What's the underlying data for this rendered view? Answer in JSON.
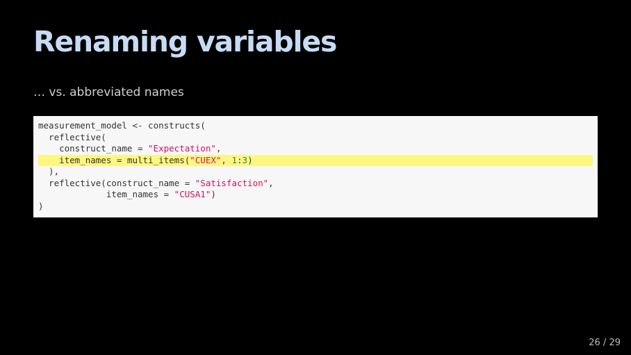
{
  "slide": {
    "title": "Renaming variables",
    "subtitle": "… vs. abbreviated names",
    "page_current": "26",
    "page_separator": " / ",
    "page_total": "29"
  },
  "code": {
    "language": "r",
    "highlighted_line_index": 3,
    "lines": [
      {
        "tokens": [
          {
            "text": "measurement_model <- constructs(",
            "kind": "plain"
          }
        ]
      },
      {
        "tokens": [
          {
            "text": "  reflective(",
            "kind": "plain"
          }
        ]
      },
      {
        "tokens": [
          {
            "text": "    construct_name = ",
            "kind": "plain"
          },
          {
            "text": "\"Expectation\"",
            "kind": "string"
          },
          {
            "text": ",",
            "kind": "plain"
          }
        ]
      },
      {
        "tokens": [
          {
            "text": "    item_names = multi_items(",
            "kind": "plain"
          },
          {
            "text": "\"CUEX\"",
            "kind": "string"
          },
          {
            "text": ", ",
            "kind": "plain"
          },
          {
            "text": "1",
            "kind": "number"
          },
          {
            "text": ":",
            "kind": "plain"
          },
          {
            "text": "3",
            "kind": "number"
          },
          {
            "text": ")",
            "kind": "plain"
          }
        ]
      },
      {
        "tokens": [
          {
            "text": "  ),",
            "kind": "plain"
          }
        ]
      },
      {
        "tokens": [
          {
            "text": "  reflective(construct_name = ",
            "kind": "plain"
          },
          {
            "text": "\"Satisfaction\"",
            "kind": "string"
          },
          {
            "text": ",",
            "kind": "plain"
          }
        ]
      },
      {
        "tokens": [
          {
            "text": "             item_names = ",
            "kind": "plain"
          },
          {
            "text": "\"CUSA1\"",
            "kind": "string"
          },
          {
            "text": ")",
            "kind": "plain"
          }
        ]
      },
      {
        "tokens": [
          {
            "text": ")",
            "kind": "plain"
          }
        ]
      }
    ]
  },
  "colors": {
    "background": "#000000",
    "title": "#c6dcf5",
    "subtitle": "#d0d0d0",
    "code_background": "#f7f7f7",
    "code_text": "#333333",
    "code_string": "#d0105e",
    "code_number": "#1f8a6e",
    "highlight": "#fff67f",
    "page_number": "#bdbdbd"
  }
}
